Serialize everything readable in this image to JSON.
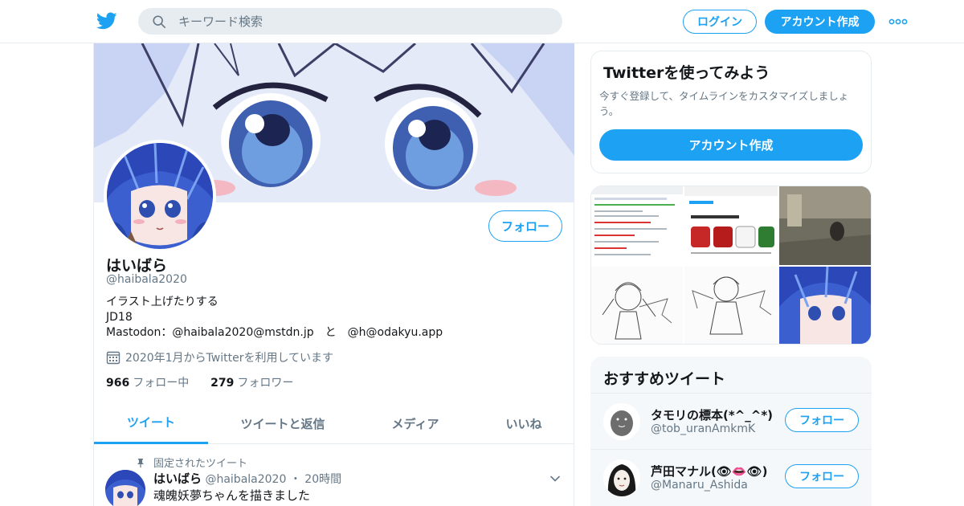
{
  "header": {
    "search_placeholder": "キーワード検索",
    "login_label": "ログイン",
    "signup_label": "アカウント作成",
    "brand_color": "#1da1f2",
    "logo_icon": "twitter-bird-icon"
  },
  "profile": {
    "name": "はいばら",
    "handle": "@haibala2020",
    "follow_label": "フォロー",
    "bio_line1": "イラスト上げたりする",
    "bio_line2": "JD18",
    "bio_line3": "Mastodon：@haibala2020@mstdn.jp　と　@h@odakyu.app",
    "joined": "2020年1月からTwitterを利用しています",
    "following_count": "966",
    "following_label": "フォロー中",
    "followers_count": "279",
    "followers_label": "フォロワー"
  },
  "tabs": [
    {
      "label": "ツイート",
      "active": true
    },
    {
      "label": "ツイートと返信",
      "active": false
    },
    {
      "label": "メディア",
      "active": false
    },
    {
      "label": "いいね",
      "active": false
    }
  ],
  "pinned_tweet": {
    "pinned_label": "固定されたツイート",
    "name": "はいばら",
    "handle": "@haibala2020",
    "separator": "・",
    "time": "20時間",
    "text": "魂魄妖夢ちゃんを描きました"
  },
  "sidebar": {
    "try_title": "Twitterを使ってみよう",
    "try_text": "今すぐ登録して、タイムラインをカスタマイズしましょう。",
    "try_button": "アカウント作成",
    "rec_title": "おすすめツイート",
    "recommendations": [
      {
        "name": "タモリの標本(*^_^*)",
        "handle": "@tob_uranAmkmK",
        "follow_label": "フォロー"
      },
      {
        "name": "芦田マナル(👁👄👁)",
        "handle": "@Manaru_Ashida",
        "follow_label": "フォロー"
      }
    ]
  }
}
